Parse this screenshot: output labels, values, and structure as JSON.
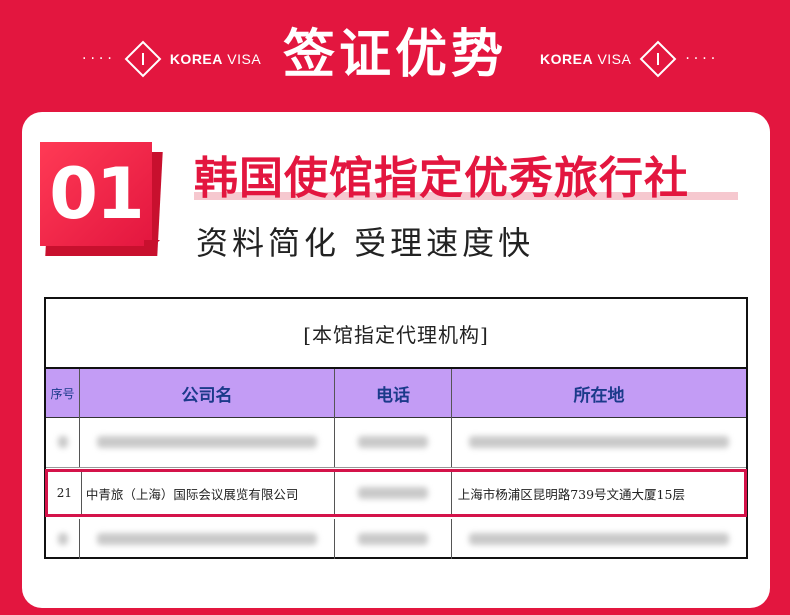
{
  "header": {
    "title": "签证优势",
    "side_label_bold": "KOREA",
    "side_label_light": " VISA",
    "dots": "····"
  },
  "badge": {
    "number": "01"
  },
  "main_title": "韩国使馆指定优秀旅行社",
  "sub_title": "资料简化 受理速度快",
  "table": {
    "caption": "[本馆指定代理机构]",
    "headers": {
      "seq": "序号",
      "company": "公司名",
      "phone": "电话",
      "address": "所在地"
    },
    "highlighted_row": {
      "seq": "21",
      "company": "中青旅（上海）国际会议展览有限公司",
      "address": "上海市杨浦区昆明路739号文通大厦15层"
    }
  },
  "colors": {
    "brand_red": "#e3163f",
    "header_purple": "#c39cf5",
    "highlight_border": "#d4134a"
  }
}
